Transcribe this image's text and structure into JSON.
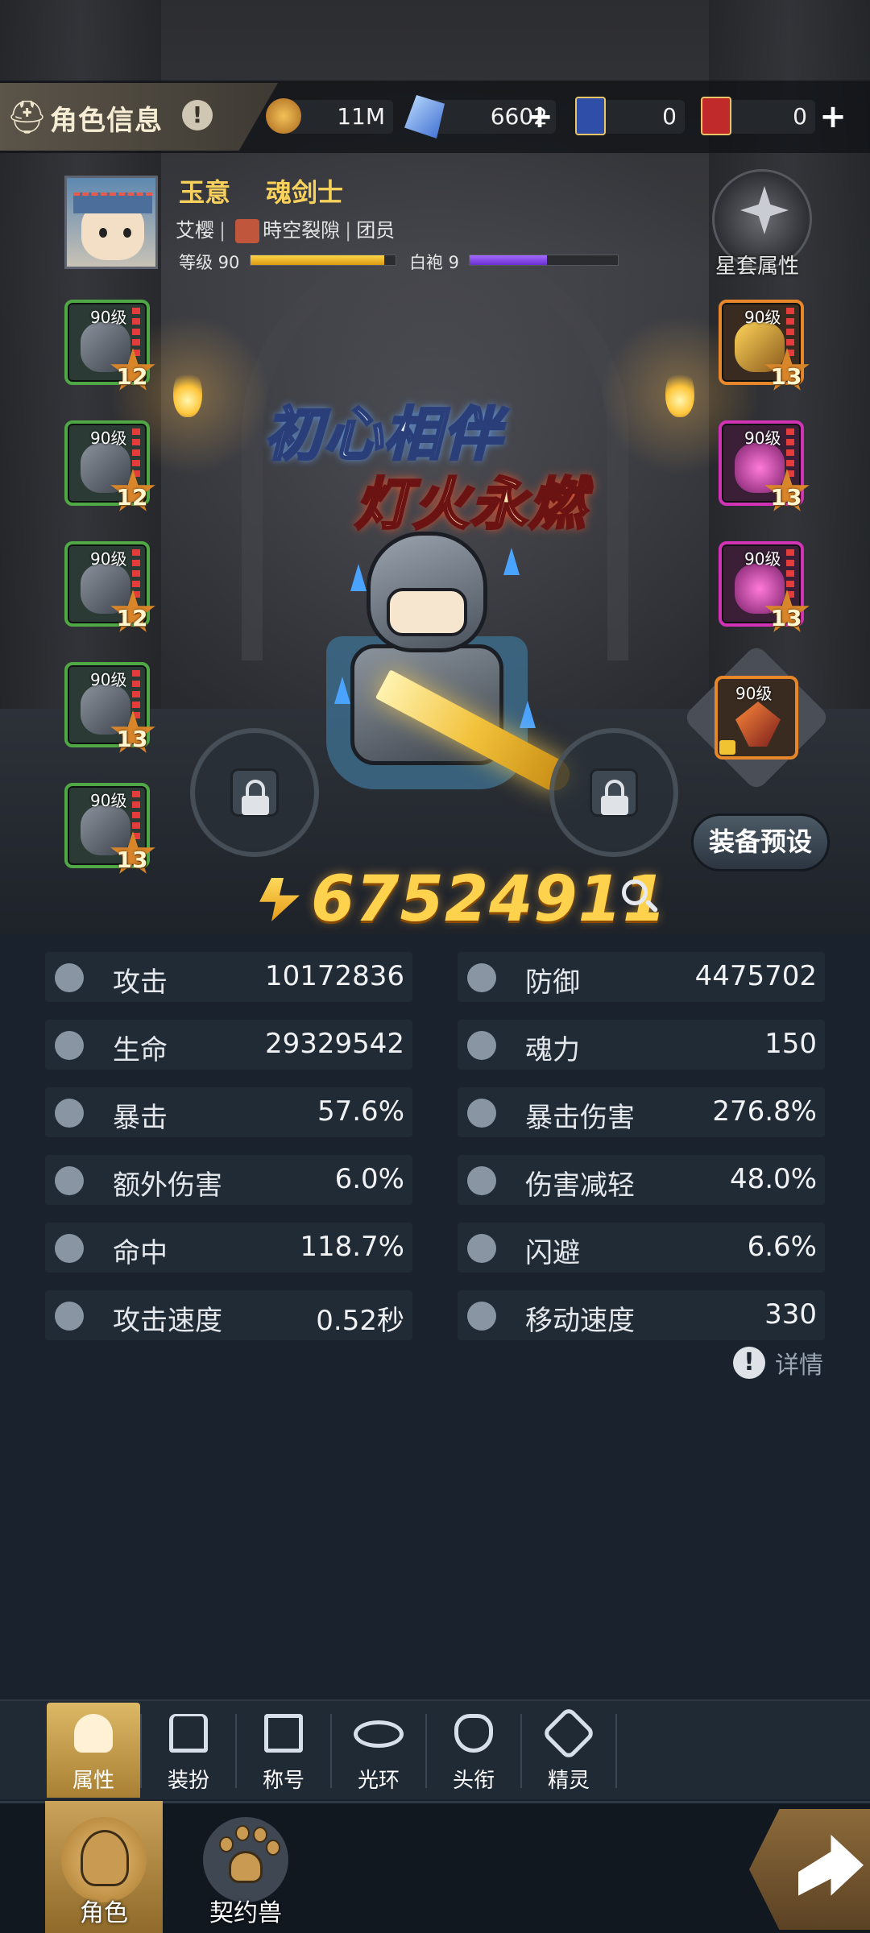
{
  "header": {
    "title": "角色信息",
    "info_icon": "!",
    "currencies": [
      {
        "name": "gold-coin",
        "value": "11M",
        "color": "#d4902c"
      },
      {
        "name": "blue-crystal",
        "value": "6602",
        "color": "#4a7ad8"
      },
      {
        "name": "blue-card",
        "value": "0",
        "color": "#2e4ea8"
      },
      {
        "name": "red-card",
        "value": "0",
        "color": "#c02a2a"
      }
    ]
  },
  "profile": {
    "name": "玉意",
    "class": "魂剑士",
    "server": "艾樱",
    "guild": "時空裂隙",
    "role": "团员",
    "level_label": "等级 90",
    "level_progress": 0.92,
    "robe_label": "白袍 9",
    "robe_progress": 0.52,
    "star_set_label": "星套属性"
  },
  "equipment": {
    "left": [
      {
        "level": "90级",
        "stars": "12",
        "rarity": "green"
      },
      {
        "level": "90级",
        "stars": "12",
        "rarity": "green"
      },
      {
        "level": "90级",
        "stars": "12",
        "rarity": "green"
      },
      {
        "level": "90级",
        "stars": "13",
        "rarity": "green"
      },
      {
        "level": "90级",
        "stars": "13",
        "rarity": "green"
      }
    ],
    "right": [
      {
        "level": "90级",
        "stars": "13",
        "rarity": "orange"
      },
      {
        "level": "90级",
        "stars": "13",
        "rarity": "pink"
      },
      {
        "level": "90级",
        "stars": "13",
        "rarity": "pink"
      }
    ],
    "relic": {
      "level": "90级"
    }
  },
  "banner": {
    "line1": "初心相伴",
    "line2": "灯火永燃"
  },
  "preset_button": "装备预设",
  "combat_power": "67524911",
  "stats": [
    {
      "label": "攻击",
      "value": "10172836",
      "icon": "sword-icon"
    },
    {
      "label": "防御",
      "value": "4475702",
      "icon": "shield-icon"
    },
    {
      "label": "生命",
      "value": "29329542",
      "icon": "heart-icon"
    },
    {
      "label": "魂力",
      "value": "150",
      "icon": "soul-icon"
    },
    {
      "label": "暴击",
      "value": "57.6%",
      "icon": "crit-icon"
    },
    {
      "label": "暴击伤害",
      "value": "276.8%",
      "icon": "crit-damage-icon"
    },
    {
      "label": "额外伤害",
      "value": "6.0%",
      "icon": "extra-damage-icon"
    },
    {
      "label": "伤害减轻",
      "value": "48.0%",
      "icon": "damage-reduction-icon"
    },
    {
      "label": "命中",
      "value": "118.7%",
      "icon": "accuracy-icon"
    },
    {
      "label": "闪避",
      "value": "6.6%",
      "icon": "dodge-icon"
    },
    {
      "label": "攻击速度",
      "value": "0.52秒",
      "icon": "attack-speed-icon"
    },
    {
      "label": "移动速度",
      "value": "330",
      "icon": "move-speed-icon"
    }
  ],
  "details_link": "详情",
  "sub_tabs": [
    {
      "label": "属性",
      "icon": "person-icon",
      "active": true
    },
    {
      "label": "装扮",
      "icon": "hanger-icon",
      "active": false
    },
    {
      "label": "称号",
      "icon": "crown-icon",
      "active": false
    },
    {
      "label": "光环",
      "icon": "halo-icon",
      "active": false
    },
    {
      "label": "头衔",
      "icon": "emblem-icon",
      "active": false
    },
    {
      "label": "精灵",
      "icon": "spirit-icon",
      "active": false
    }
  ],
  "bottom_tabs": [
    {
      "label": "角色",
      "icon": "character-icon",
      "active": true
    },
    {
      "label": "契约兽",
      "icon": "paw-icon",
      "active": false
    }
  ]
}
